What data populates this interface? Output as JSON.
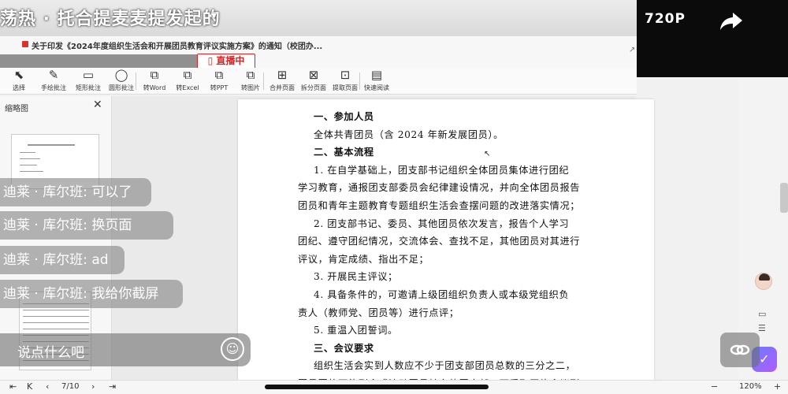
{
  "live": {
    "title": "荡热 · 托合提麦麦提发起的",
    "quality": "720P",
    "badge": "直播中"
  },
  "document": {
    "title": "关于印发《2024年度组织生活会和开展团员教育评议实施方案》的通知（校团办...",
    "paragraphs": [
      {
        "text": "一、参加人员",
        "bold": true
      },
      {
        "text": "全体共青团员（含 2024 年新发展团员）。",
        "bold": false
      },
      {
        "text": "二、基本流程",
        "bold": true
      },
      {
        "text": "1. 在自学基础上，团支部书记组织全体团员集体进行团纪",
        "bold": false
      },
      {
        "text": "学习教育，通报团支部委员会纪律建设情况，并向全体团员报告",
        "bold": false
      },
      {
        "text": "团员和青年主题教育专题组织生活会查摆问题的改进落实情况；",
        "bold": false
      },
      {
        "text": "2. 团支部书记、委员、其他团员依次发言，报告个人学习",
        "bold": false
      },
      {
        "text": "团纪、遵守团纪情况，交流体会、查找不足，其他团员对其进行",
        "bold": false
      },
      {
        "text": "评议，肯定成绩、指出不足；",
        "bold": false
      },
      {
        "text": "3. 开展民主评议；",
        "bold": false
      },
      {
        "text": "4. 具备条件的，可邀请上级团组织负责人或本级党组织负",
        "bold": false
      },
      {
        "text": "责人（教师党、团员等）进行点评；",
        "bold": false
      },
      {
        "text": "5. 重温入团誓词。",
        "bold": false
      },
      {
        "text": "三、会议要求",
        "bold": true
      },
      {
        "text": "组织生活会实到人数应不少于团支部团员总数的三分之二，",
        "bold": false
      },
      {
        "text": "团员因故不能到会或流动团员较多的团支部，可采取网络会议形",
        "bold": false
      }
    ]
  },
  "toolbar": {
    "tools": [
      {
        "label": "选择",
        "icon": "cursor-icon",
        "glyph": "⬉",
        "red": false
      },
      {
        "label": "手绘批注",
        "icon": "pen-icon",
        "glyph": "✎",
        "red": false
      },
      {
        "label": "矩形批注",
        "icon": "rectangle-icon",
        "glyph": "▭",
        "red": false
      },
      {
        "label": "圆形批注",
        "icon": "circle-icon",
        "glyph": "◯",
        "red": false
      },
      {
        "label": "转Word",
        "icon": "to-word-icon",
        "glyph": "⧉",
        "red": false
      },
      {
        "label": "转Excel",
        "icon": "to-excel-icon",
        "glyph": "⧉",
        "red": false
      },
      {
        "label": "转PPT",
        "icon": "to-ppt-icon",
        "glyph": "⧉",
        "red": false
      },
      {
        "label": "转图片",
        "icon": "to-image-icon",
        "glyph": "⧉",
        "red": false
      },
      {
        "label": "合并页面",
        "icon": "merge-pages-icon",
        "glyph": "⊞",
        "red": false
      },
      {
        "label": "拆分页面",
        "icon": "split-pages-icon",
        "glyph": "⊠",
        "red": false
      },
      {
        "label": "提取页面",
        "icon": "extract-pages-icon",
        "glyph": "⊡",
        "red": false
      },
      {
        "label": "快速阅读",
        "icon": "quick-read-icon",
        "glyph": "▤",
        "red": false
      }
    ]
  },
  "thumbnails": {
    "title": "缩略图"
  },
  "chat": {
    "messages": [
      {
        "text": "迪莱 · 库尔班: 可以了"
      },
      {
        "text": "迪莱 · 库尔班: 换页面"
      },
      {
        "text": "迪莱 · 库尔班: ad"
      },
      {
        "text": "迪莱 · 库尔班: 我给你截屏"
      }
    ],
    "placeholder": "说点什么吧"
  },
  "pagination": {
    "current_page": "7/10"
  },
  "zoom": {
    "level": "120%"
  }
}
